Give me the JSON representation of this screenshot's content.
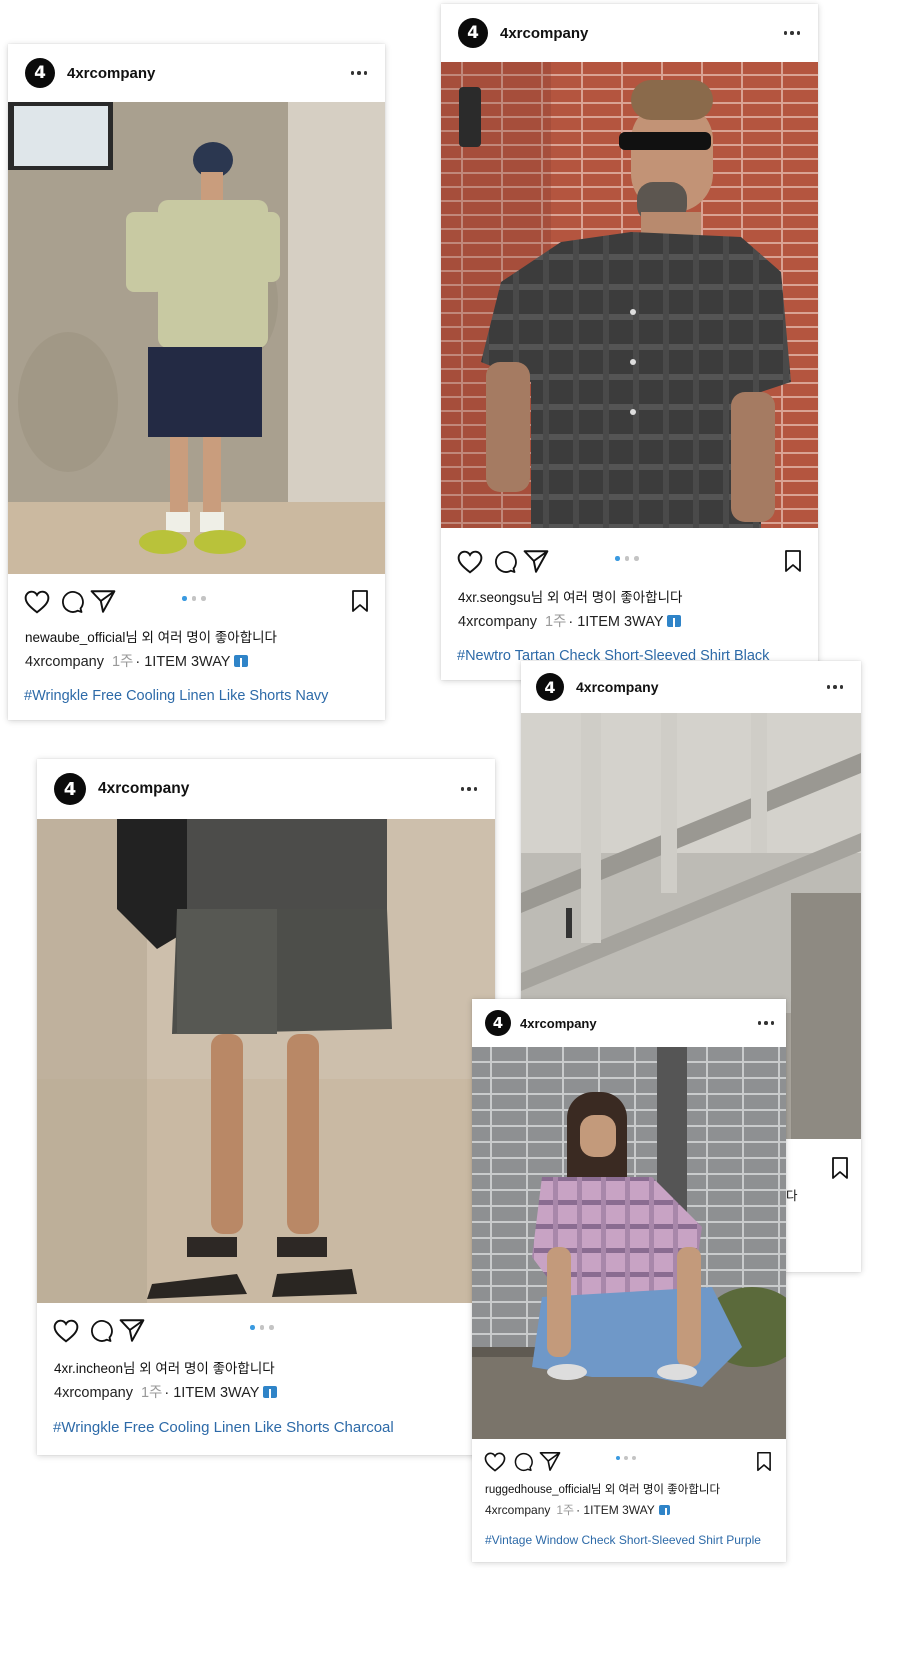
{
  "colors": {
    "accent": "#3a9ae0",
    "hashtag": "#2d6aa8",
    "brand": "#0b0b0b"
  },
  "icons": [
    "heart-icon",
    "comment-icon",
    "share-icon",
    "bookmark-icon",
    "more-icon",
    "brand-logo-icon"
  ],
  "posts": [
    {
      "avatar": "4",
      "username": "4xrcompany",
      "likes": "newaube_official님 외 여러 명이 좋아합니다",
      "author": "4xrcompany",
      "time": "1주",
      "caption": "· 1ITEM 3WAY",
      "hashtag": "#Wringkle Free Cooling Linen Like Shorts Navy",
      "carousel_active": 1,
      "carousel_total": 3
    },
    {
      "avatar": "4",
      "username": "4xrcompany",
      "likes": "4xr.seongsu님 외 여러 명이 좋아합니다",
      "author": "4xrcompany",
      "time": "1주",
      "caption": "· 1ITEM 3WAY",
      "hashtag": "#Newtro Tartan Check Short-Sleeved Shirt Black",
      "carousel_active": 1,
      "carousel_total": 3
    },
    {
      "avatar": "4",
      "username": "4xrcompany",
      "likes": "4xr.incheon님 외 여러 명이 좋아합니다",
      "author": "4xrcompany",
      "time": "1주",
      "caption": "· 1ITEM 3WAY",
      "hashtag": "#Wringkle Free Cooling Linen Like Shorts Charcoal",
      "carousel_active": 1,
      "carousel_total": 3
    },
    {
      "avatar": "4",
      "username": "4xrcompany",
      "likes_visible_fragment": "다"
    },
    {
      "avatar": "4",
      "username": "4xrcompany",
      "likes": "ruggedhouse_official님 외 여러 명이 좋아합니다",
      "author": "4xrcompany",
      "time": "1주",
      "caption": "· 1ITEM 3WAY",
      "hashtag": "#Vintage Window Check Short-Sleeved Shirt Purple",
      "carousel_active": 1,
      "carousel_total": 3
    }
  ]
}
